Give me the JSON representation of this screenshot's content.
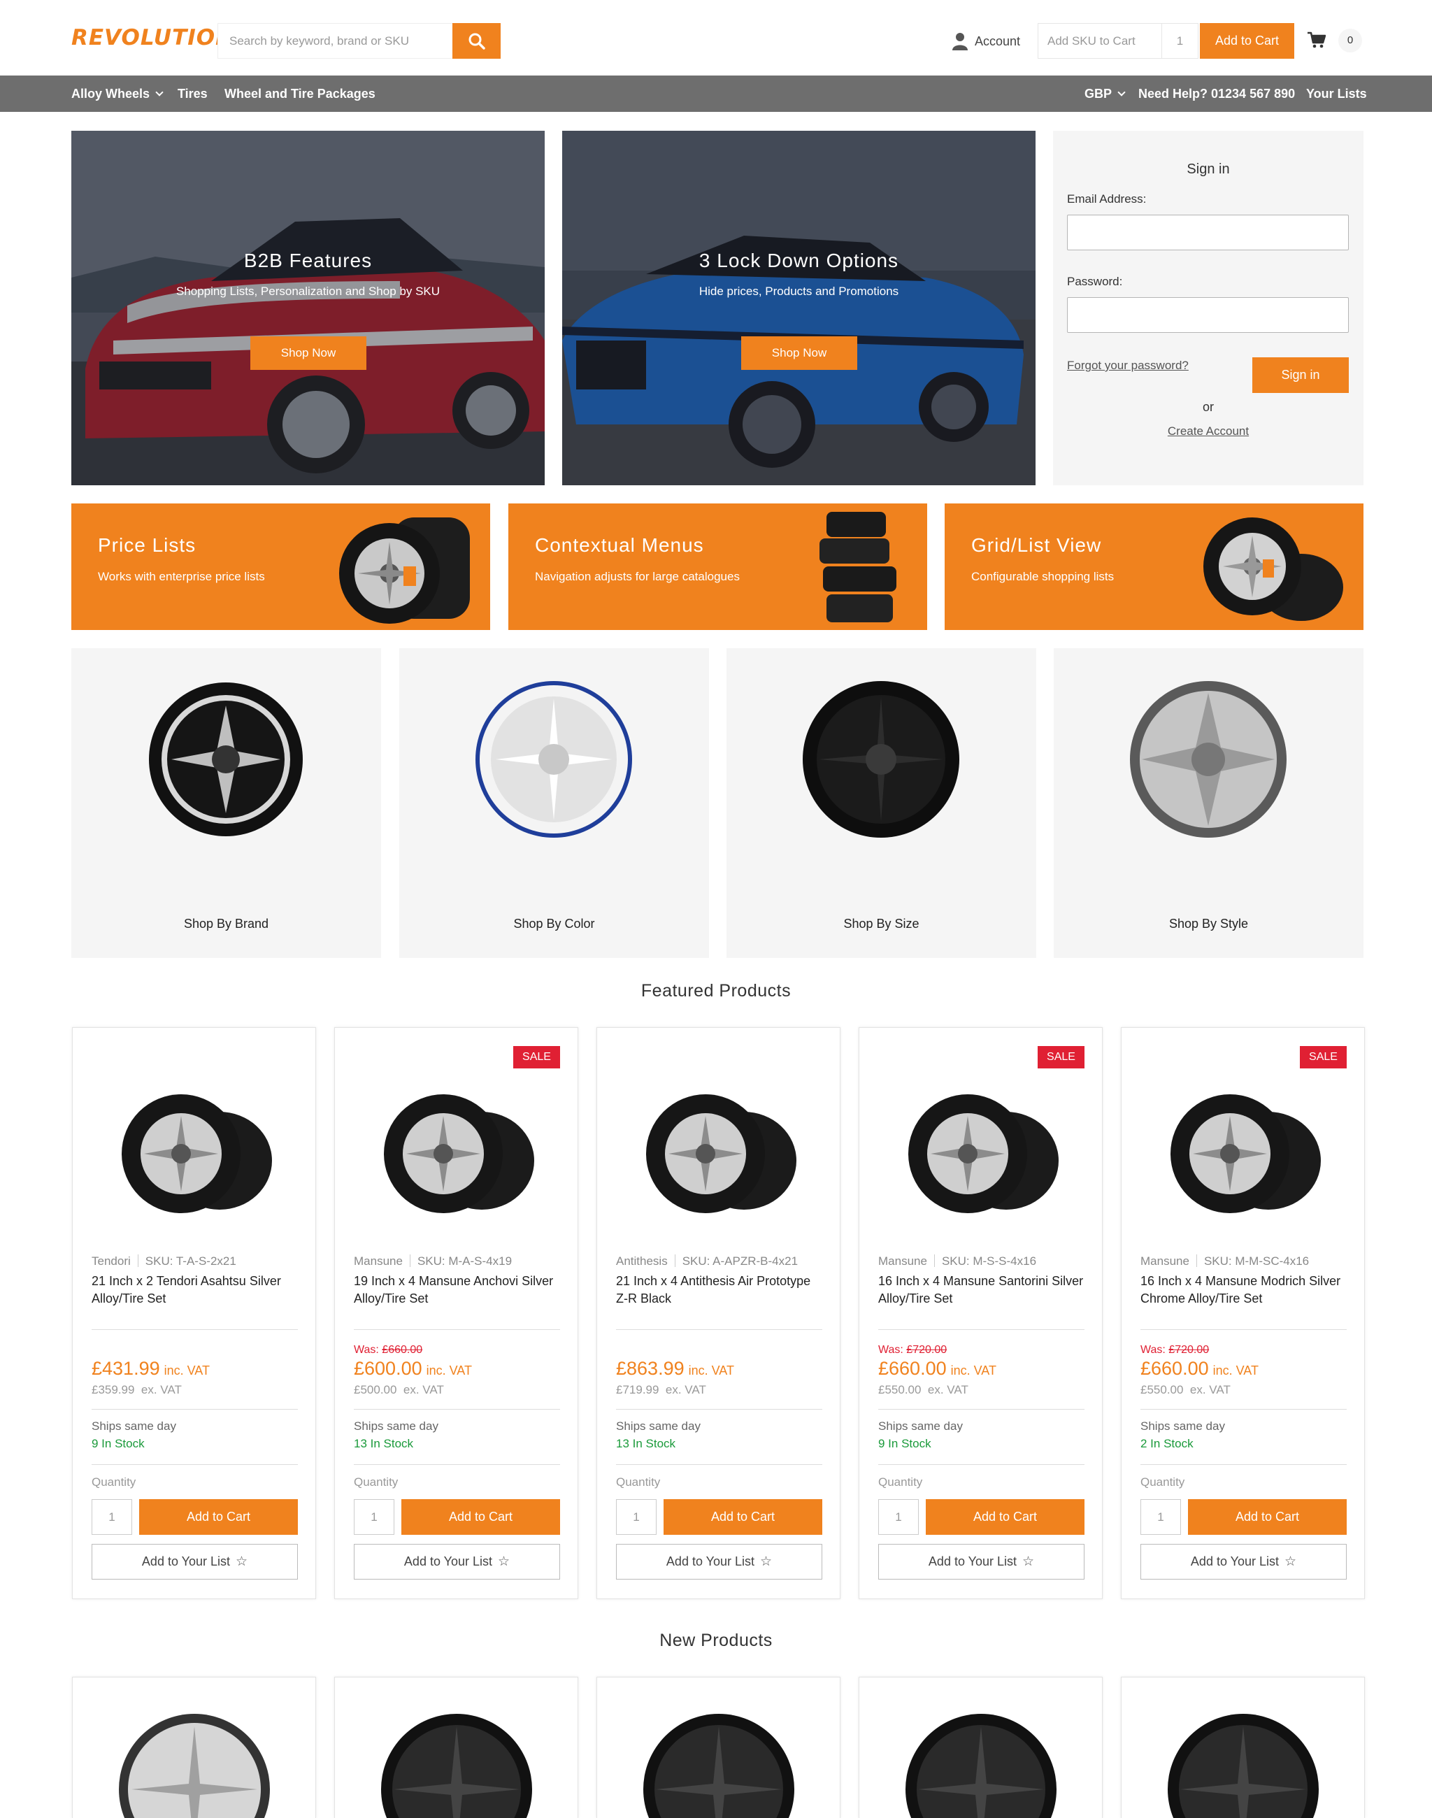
{
  "colors": {
    "accent": "#f0821e",
    "nav_bg": "#6e6e6e",
    "sale": "#e02033",
    "in_stock": "#1a9a3a"
  },
  "header": {
    "logo": "REVOLUTION",
    "search_placeholder": "Search by keyword, brand or SKU",
    "account_label": "Account",
    "sku_placeholder": "Add SKU to Cart",
    "sku_qty": "1",
    "add_to_cart": "Add to Cart",
    "cart_count": "0"
  },
  "nav": {
    "left": [
      "Alloy Wheels",
      "Tires",
      "Wheel and Tire Packages"
    ],
    "currency": "GBP",
    "help": "Need Help? 01234 567 890",
    "lists": "Your Lists"
  },
  "hero": [
    {
      "title": "B2B Features",
      "subtitle": "Shopping Lists, Personalization and Shop by SKU",
      "button": "Shop Now"
    },
    {
      "title": "3 Lock Down Options",
      "subtitle": "Hide prices, Products and Promotions",
      "button": "Shop Now"
    }
  ],
  "signin": {
    "heading": "Sign in",
    "email_label": "Email Address:",
    "password_label": "Password:",
    "forgot": "Forgot your password?",
    "button": "Sign in",
    "or": "or",
    "create": "Create Account"
  },
  "promos": [
    {
      "title": "Price Lists",
      "subtitle": "Works with enterprise price lists"
    },
    {
      "title": "Contextual Menus",
      "subtitle": "Navigation adjusts for large catalogues"
    },
    {
      "title": "Grid/List View",
      "subtitle": "Configurable shopping lists"
    }
  ],
  "tiles": [
    "Shop By Brand",
    "Shop By Color",
    "Shop By Size",
    "Shop By Style"
  ],
  "featured_title": "Featured Products",
  "new_title": "New Products",
  "product_ui": {
    "inc_vat": "inc. VAT",
    "ex_vat": "ex. VAT",
    "was": "Was:",
    "quantity_label": "Quantity",
    "qty_value": "1",
    "add_to_cart": "Add to Cart",
    "add_to_list": "Add to Your List",
    "sale_badge": "SALE"
  },
  "products": [
    {
      "brand": "Tendori",
      "sku": "SKU: T-A-S-2x21",
      "name": "21 Inch x 2 Tendori Asahtsu Silver Alloy/Tire Set",
      "sale": false,
      "was": "",
      "price": "£431.99",
      "ex": "£359.99",
      "ships": "Ships same day",
      "stock": "9 In Stock"
    },
    {
      "brand": "Mansune",
      "sku": "SKU: M-A-S-4x19",
      "name": "19 Inch x 4 Mansune Anchovi Silver Alloy/Tire Set",
      "sale": true,
      "was": "£660.00",
      "price": "£600.00",
      "ex": "£500.00",
      "ships": "Ships same day",
      "stock": "13 In Stock"
    },
    {
      "brand": "Antithesis",
      "sku": "SKU: A-APZR-B-4x21",
      "name": "21 Inch x 4 Antithesis Air Prototype Z-R Black",
      "sale": false,
      "was": "",
      "price": "£863.99",
      "ex": "£719.99",
      "ships": "Ships same day",
      "stock": "13 In Stock"
    },
    {
      "brand": "Mansune",
      "sku": "SKU: M-S-S-4x16",
      "name": "16 Inch x 4 Mansune Santorini Silver Alloy/Tire Set",
      "sale": true,
      "was": "£720.00",
      "price": "£660.00",
      "ex": "£550.00",
      "ships": "Ships same day",
      "stock": "9 In Stock"
    },
    {
      "brand": "Mansune",
      "sku": "SKU: M-M-SC-4x16",
      "name": "16 Inch x 4 Mansune Modrich Silver Chrome Alloy/Tire Set",
      "sale": true,
      "was": "£720.00",
      "price": "£660.00",
      "ex": "£550.00",
      "ships": "Ships same day",
      "stock": "2 In Stock"
    }
  ]
}
